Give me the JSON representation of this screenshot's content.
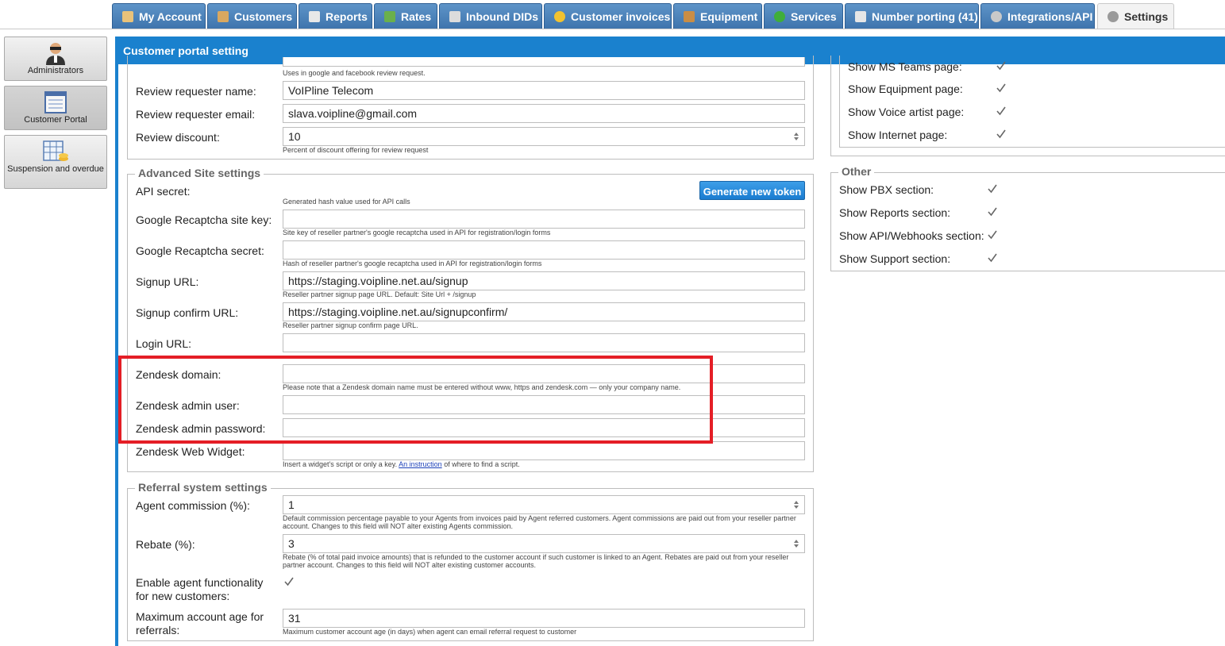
{
  "tabs": [
    {
      "label": "My Account",
      "icon": "user-icon"
    },
    {
      "label": "Customers",
      "icon": "customers-icon"
    },
    {
      "label": "Reports",
      "icon": "reports-icon"
    },
    {
      "label": "Rates",
      "icon": "rates-icon"
    },
    {
      "label": "Inbound DIDs",
      "icon": "did-icon"
    },
    {
      "label": "Customer invoices",
      "icon": "coins-icon"
    },
    {
      "label": "Equipment",
      "icon": "box-icon"
    },
    {
      "label": "Services",
      "icon": "services-icon"
    },
    {
      "label": "Number porting (41)",
      "icon": "phone-icon"
    },
    {
      "label": "Integrations/API",
      "icon": "gear-icon"
    },
    {
      "label": "Settings",
      "icon": "settings-icon"
    }
  ],
  "sidebar": {
    "items": [
      {
        "label": "Administrators"
      },
      {
        "label": "Customer Portal"
      },
      {
        "label": "Suspension and overdue"
      }
    ]
  },
  "panel": {
    "title": "Customer portal setting"
  },
  "top": {
    "facebook_hint": "Uses in google and facebook review request.",
    "review_name_label": "Review requester name:",
    "review_name_value": "VoIPline Telecom",
    "review_email_label": "Review requester email:",
    "review_email_value": "slava.voipline@gmail.com",
    "review_discount_label": "Review discount:",
    "review_discount_value": "10",
    "review_discount_hint": "Percent of discount offering for review request"
  },
  "advanced": {
    "legend": "Advanced Site settings",
    "api_secret_label": "API secret:",
    "api_secret_hint": "Generated hash value used for API calls",
    "generate_token": "Generate new token",
    "recaptcha_key_label": "Google Recaptcha site key:",
    "recaptcha_key_hint": "Site key of reseller partner's google recaptcha used in API for registration/login forms",
    "recaptcha_secret_label": "Google Recaptcha secret:",
    "recaptcha_secret_hint": "Hash of reseller partner's google recaptcha used in API for registration/login forms",
    "signup_label": "Signup URL:",
    "signup_value": "https://staging.voipline.net.au/signup",
    "signup_hint": "Reseller partner signup page URL. Default: Site Url + /signup",
    "signup_confirm_label": "Signup confirm URL:",
    "signup_confirm_value": "https://staging.voipline.net.au/signupconfirm/",
    "signup_confirm_hint": "Reseller partner signup confirm page URL.",
    "login_label": "Login URL:",
    "zendesk_domain_label": "Zendesk domain:",
    "zendesk_domain_hint": "Please note that a Zendesk domain name must be entered without www, https and zendesk.com — only your company name.",
    "zendesk_user_label": "Zendesk admin user:",
    "zendesk_password_label": "Zendesk admin password:",
    "zendesk_widget_label": "Zendesk Web Widget:",
    "zendesk_widget_hint_pre": "Insert a widget's script or only a key.",
    "zendesk_widget_link": "An instruction",
    "zendesk_widget_hint_post": "of where to find a script."
  },
  "referral": {
    "legend": "Referral system settings",
    "agent_commission_label": "Agent commission (%):",
    "agent_commission_value": "1",
    "agent_commission_hint": "Default commission percentage payable to your Agents from invoices paid by Agent referred customers. Agent commissions are paid out from your reseller partner account. Changes to this field will NOT alter existing Agents commission.",
    "rebate_label": "Rebate (%):",
    "rebate_value": "3",
    "rebate_hint": "Rebate (% of total paid invoice amounts) that is refunded to the customer account if such customer is linked to an Agent. Rebates are paid out from your reseller partner account. Changes to this field will NOT alter existing customer accounts.",
    "enable_agent_label": "Enable agent functionality for new customers:",
    "max_age_label": "Maximum account age for referrals:",
    "max_age_value": "31",
    "max_age_hint": "Maximum customer account age (in days) when agent can email referral request to customer"
  },
  "pages": {
    "items": [
      {
        "label": "Show MS Teams page:"
      },
      {
        "label": "Show Equipment page:"
      },
      {
        "label": "Show Voice artist page:"
      },
      {
        "label": "Show Internet page:"
      }
    ]
  },
  "other": {
    "legend": "Other",
    "items": [
      {
        "label": "Show PBX section:"
      },
      {
        "label": "Show Reports section:"
      },
      {
        "label": "Show API/Webhooks section:"
      },
      {
        "label": "Show Support section:"
      }
    ]
  },
  "colors": {
    "accent": "#1a81ce",
    "highlight": "#e41e26",
    "tab": "#4a80b8"
  }
}
